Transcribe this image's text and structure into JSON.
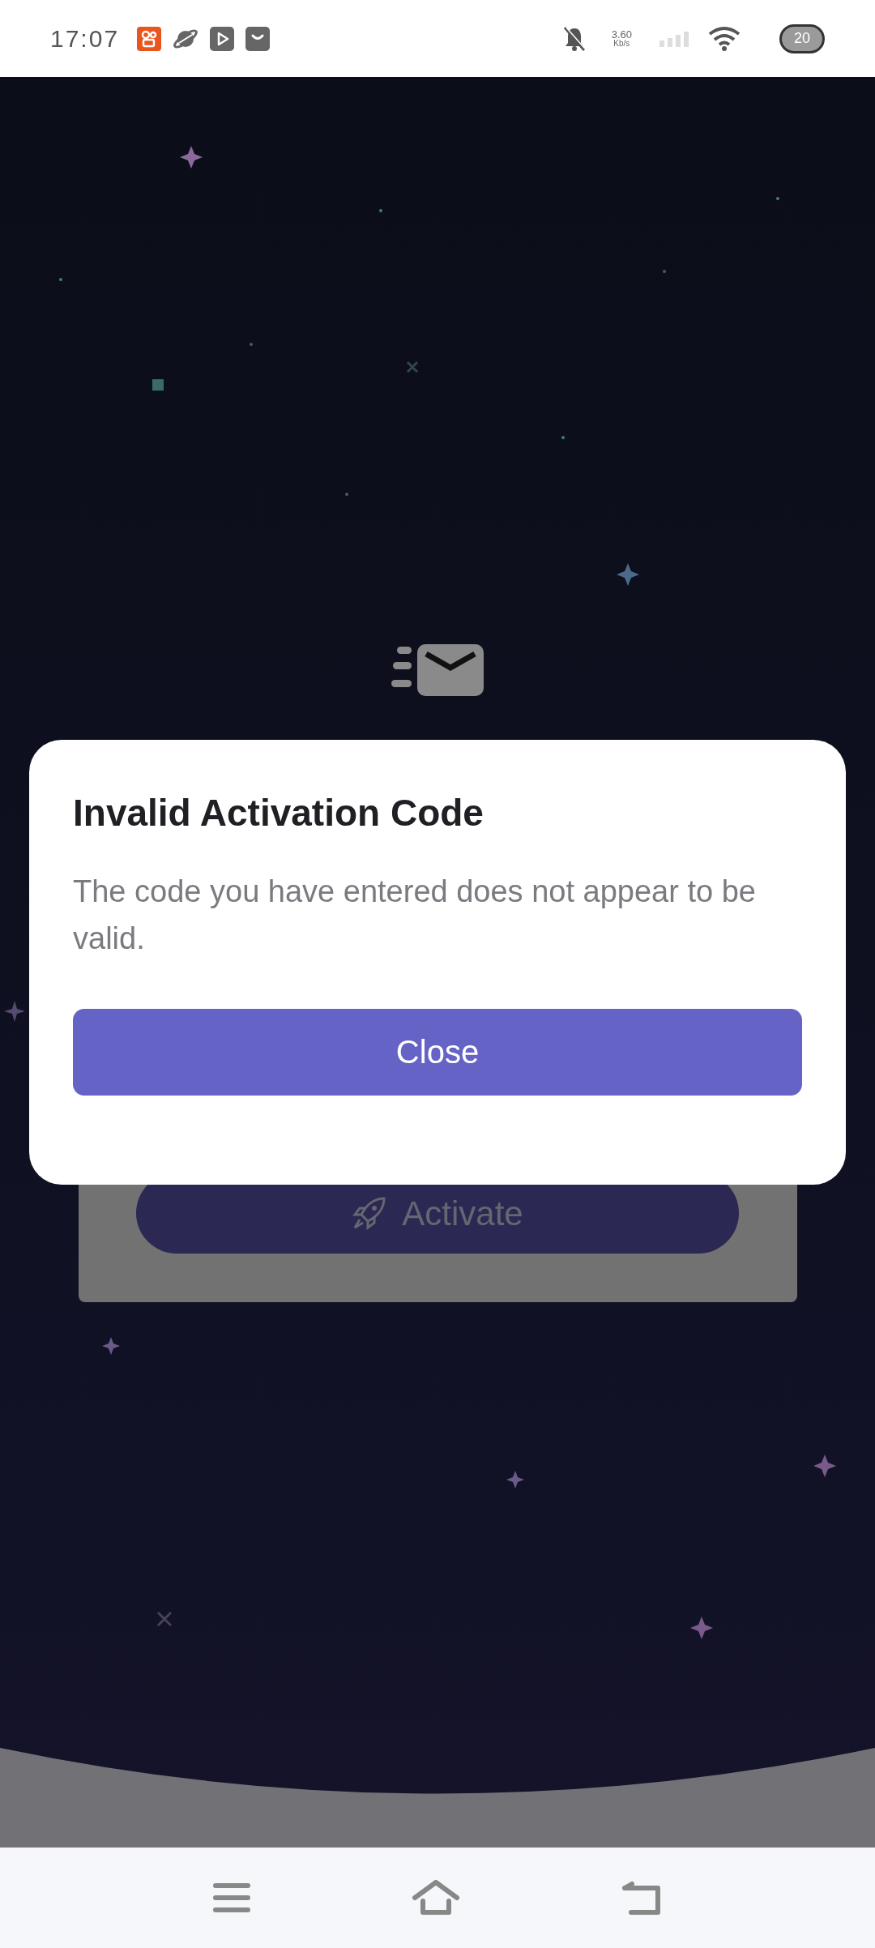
{
  "status_bar": {
    "time": "17:07",
    "network_speed": "3.60",
    "network_speed_unit": "Kb/s",
    "battery": "20"
  },
  "background": {
    "activate_button": {
      "label": "Activate"
    }
  },
  "dialog": {
    "title": "Invalid Activation Code",
    "message": "The code you have entered does not appear to be valid.",
    "button": "Close"
  }
}
